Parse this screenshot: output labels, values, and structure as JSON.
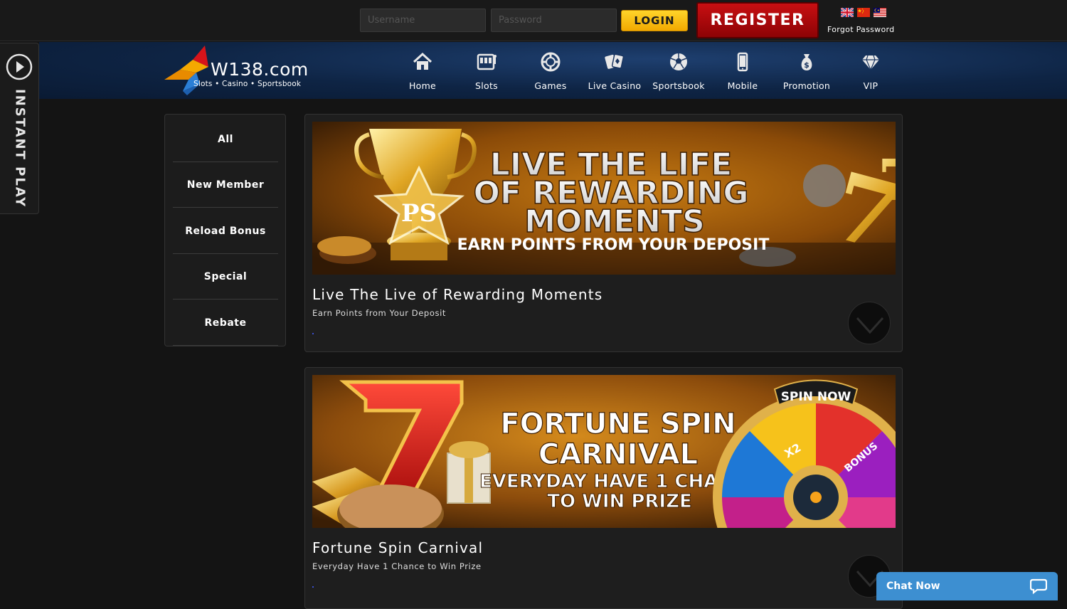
{
  "login": {
    "username_placeholder": "Username",
    "password_placeholder": "Password",
    "login_label": "LOGIN",
    "register_label": "REGISTER",
    "forgot_label": "Forgot Password",
    "languages": [
      "uk-flag-icon",
      "china-flag-icon",
      "malaysia-flag-icon"
    ]
  },
  "brand": {
    "name": "W138.com",
    "tagline": "Slots • Casino • Sportsbook"
  },
  "nav": [
    {
      "label": "Home",
      "icon": "home-icon"
    },
    {
      "label": "Slots",
      "icon": "slot-machine-icon"
    },
    {
      "label": "Games",
      "icon": "poker-chip-icon"
    },
    {
      "label": "Live Casino",
      "icon": "playing-cards-icon"
    },
    {
      "label": "Sportsbook",
      "icon": "soccer-ball-icon"
    },
    {
      "label": "Mobile",
      "icon": "mobile-phone-icon"
    },
    {
      "label": "Promotion",
      "icon": "money-bag-icon"
    },
    {
      "label": "VIP",
      "icon": "diamond-icon"
    }
  ],
  "instant_play": {
    "label": "INSTANT PLAY"
  },
  "categories": [
    "All",
    "New Member",
    "Reload Bonus",
    "Special",
    "Rebate"
  ],
  "promotions": [
    {
      "title": "Live The Live of Rewarding Moments",
      "subtitle": "Earn Points from Your Deposit",
      "banner_lines": [
        "LIVE THE LIFE",
        "OF REWARDING",
        "MOMENTS",
        "EARN POINTS FROM YOUR DEPOSIT"
      ],
      "banner_badge": "PS"
    },
    {
      "title": "Fortune Spin Carnival",
      "subtitle": "Everyday Have 1 Chance to Win Prize",
      "banner_lines": [
        "FORTUNE SPIN",
        "CARNIVAL",
        "EVERYDAY HAVE 1 CHANCE",
        "TO WIN PRIZE"
      ],
      "banner_badge": "SPIN NOW",
      "wheel_labels": [
        "X2",
        "BONUS"
      ]
    }
  ],
  "chat": {
    "label": "Chat Now"
  },
  "colors": {
    "accent_yellow": "#f2a900",
    "register_red": "#b20a0d",
    "header_blue": "#0e2444",
    "chat_blue": "#3d8fd1"
  }
}
